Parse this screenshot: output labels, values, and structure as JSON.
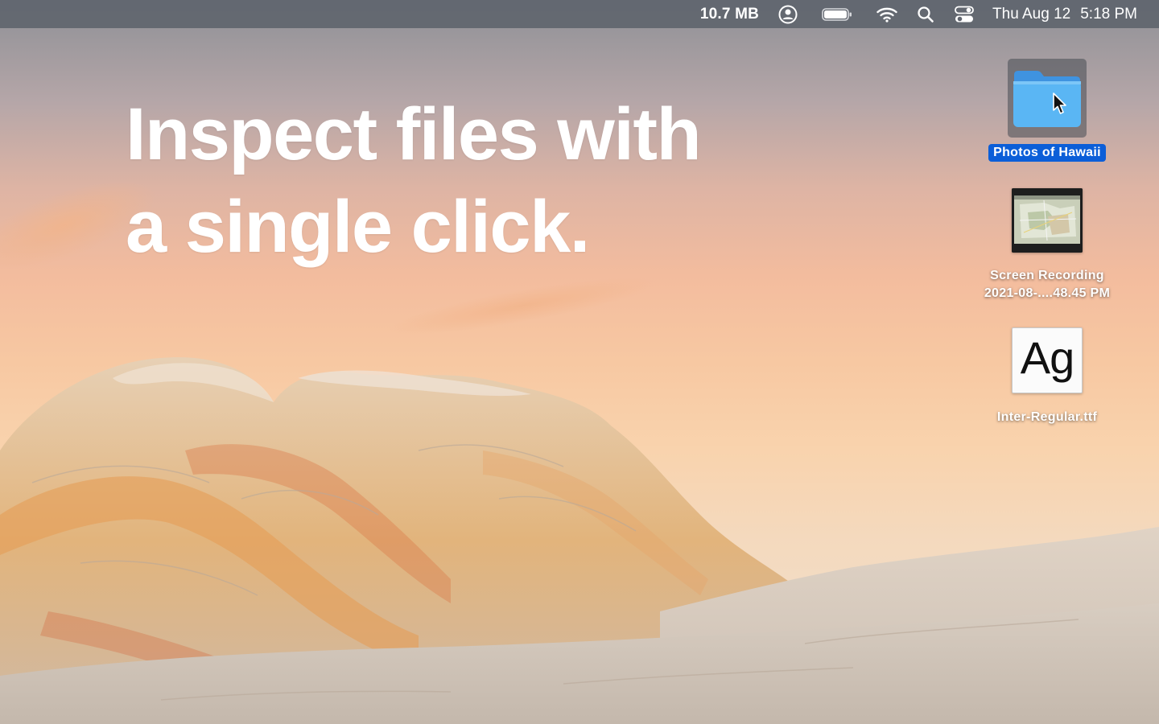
{
  "menubar": {
    "memory": "10.7 MB",
    "user_icon": "user-circle-icon",
    "battery_icon": "battery-icon",
    "wifi_icon": "wifi-icon",
    "search_icon": "search-icon",
    "control_center_icon": "control-center-icon",
    "date": "Thu Aug 12",
    "time": "5:18 PM"
  },
  "headline": {
    "line1": "Inspect files with",
    "line2": "a single click."
  },
  "desktop_icons": [
    {
      "label": "Photos of Hawaii",
      "icon": "folder-icon",
      "selected": true
    },
    {
      "label_line1": "Screen Recording",
      "label_line2": "2021-08-....48.45 PM",
      "icon": "video-thumbnail-icon"
    },
    {
      "label": "Inter-Regular.ttf",
      "icon": "font-file-icon",
      "preview": "Ag"
    }
  ],
  "colors": {
    "selection": "#0b5ed8",
    "folder_blue": "#5ab6f4",
    "menubar": "#60656e"
  }
}
